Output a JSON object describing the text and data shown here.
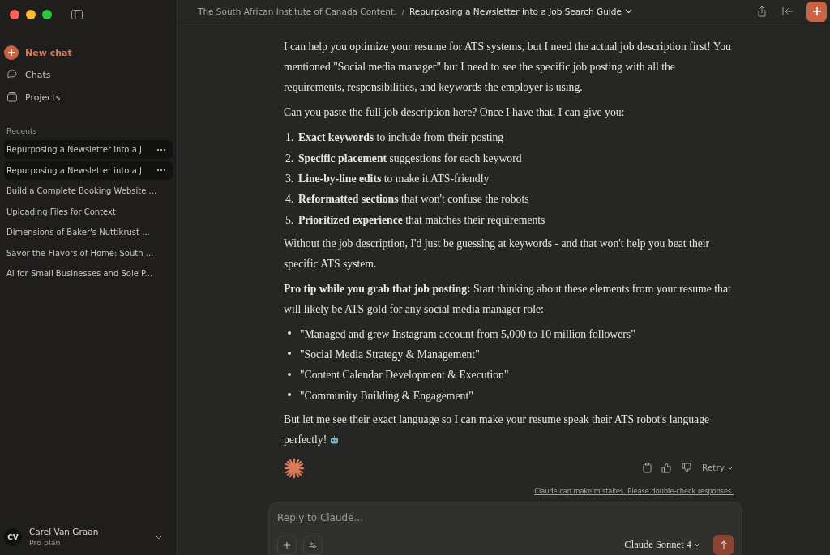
{
  "sidebar": {
    "new_chat": "New chat",
    "nav": [
      {
        "kind": "chats",
        "label": "Chats"
      },
      {
        "kind": "projects",
        "label": "Projects"
      }
    ],
    "recents_heading": "Recents",
    "recents": [
      {
        "title": "Repurposing a Newsletter into a J",
        "highlighted": true
      },
      {
        "title": "Repurposing a Newsletter into a J",
        "highlighted": true
      },
      {
        "title": "Build a Complete Booking Website ...",
        "highlighted": false
      },
      {
        "title": "Uploading Files for Context",
        "highlighted": false
      },
      {
        "title": "Dimensions of Baker's Nuttikrust ...",
        "highlighted": false
      },
      {
        "title": "Savor the Flavors of Home: South ...",
        "highlighted": false
      },
      {
        "title": "AI for Small Businesses and Sole P...",
        "highlighted": false
      }
    ],
    "user": {
      "initials": "CV",
      "name": "Carel Van Graan",
      "plan": "Pro plan"
    }
  },
  "header": {
    "project": "The South African Institute of Canada Content.",
    "separator": "/",
    "chat_title": "Repurposing a Newsletter into a Job Search Guide"
  },
  "message": {
    "blocks": [
      {
        "kind": "paragraph",
        "text": "I can help you optimize your resume for ATS systems, but I need the actual job description first! You mentioned \"Social media manager\" but I need to see the specific job posting with all the requirements, responsibilities, and keywords the employer is using."
      },
      {
        "kind": "paragraph",
        "text": "Can you paste the full job description here? Once I have that, I can give you:"
      },
      {
        "kind": "ordered",
        "items": [
          {
            "number": "1.",
            "text": "**Exact keywords** to include from their posting"
          },
          {
            "number": "2.",
            "text": "**Specific placement** suggestions for each keyword"
          },
          {
            "number": "3.",
            "text": "**Line-by-line edits** to make it ATS-friendly"
          },
          {
            "number": "4.",
            "text": "**Reformatted sections** that won't confuse the robots"
          },
          {
            "number": "5.",
            "text": "**Prioritized experience** that matches their requirements"
          }
        ]
      },
      {
        "kind": "paragraph",
        "text": "Without the job description, I'd just be guessing at keywords - and that won't help you beat their specific ATS system."
      },
      {
        "kind": "paragraph",
        "text": "**Pro tip while you grab that job posting:** Start thinking about these elements from your resume that will likely be ATS gold for any social media manager role:"
      },
      {
        "kind": "bullets",
        "items": [
          "\"Managed and grew Instagram account from 5,000 to 10 million followers\"",
          "\"Social Media Strategy & Management\"",
          "\"Content Calendar Development & Execution\"",
          "\"Community Building & Engagement\""
        ]
      },
      {
        "kind": "paragraph",
        "text": "But let me see their exact language so I can make your resume speak their ATS robot's language perfectly!",
        "robot": true
      }
    ],
    "retry": "Retry",
    "disclaimer": "Claude can make mistakes. Please double-check responses."
  },
  "composer": {
    "placeholder": "Reply to Claude...",
    "model": "Claude Sonnet 4"
  }
}
